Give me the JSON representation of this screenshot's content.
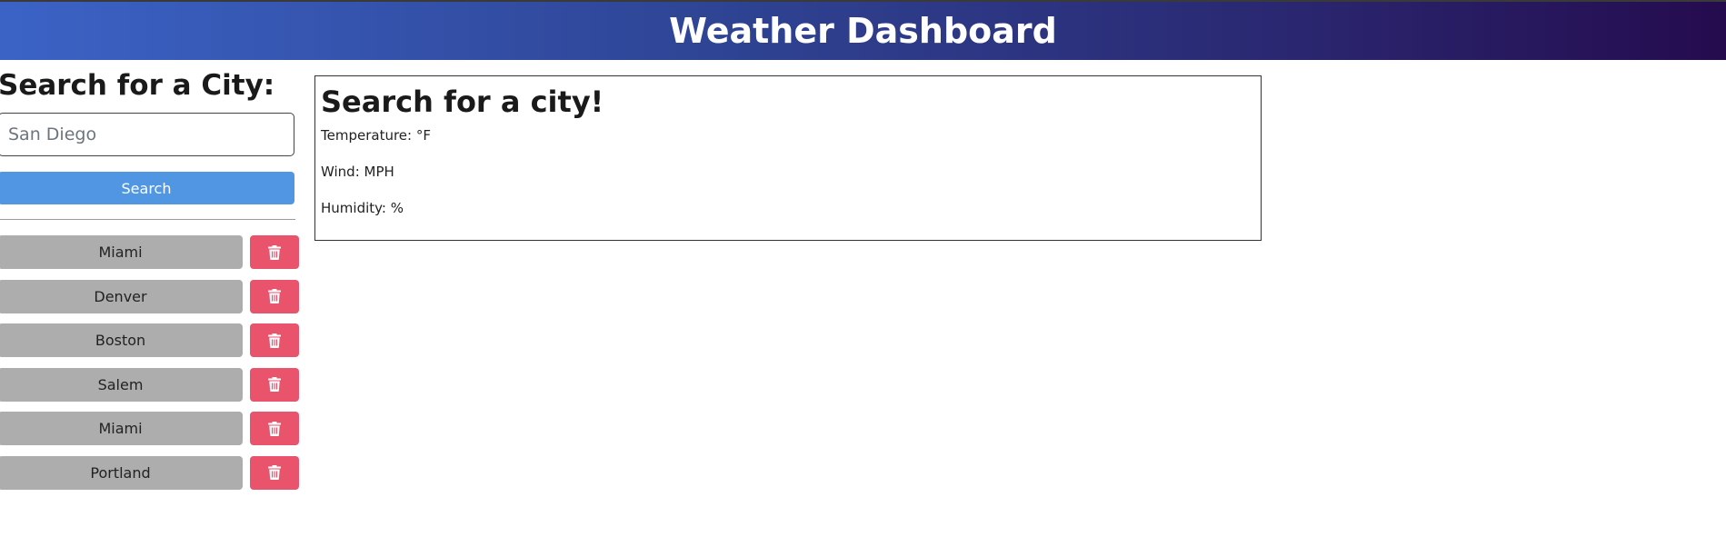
{
  "header": {
    "title": "Weather Dashboard"
  },
  "sidebar": {
    "heading": "Search for a City:",
    "search": {
      "value": "",
      "placeholder": "San Diego"
    },
    "search_button_label": "Search",
    "history": [
      {
        "city": "Miami",
        "delete_icon": "trash-icon"
      },
      {
        "city": "Denver",
        "delete_icon": "trash-icon"
      },
      {
        "city": "Boston",
        "delete_icon": "trash-icon"
      },
      {
        "city": "Salem",
        "delete_icon": "trash-icon"
      },
      {
        "city": "Miami",
        "delete_icon": "trash-icon"
      },
      {
        "city": "Portland",
        "delete_icon": "trash-icon"
      }
    ]
  },
  "current": {
    "title": "Search for a city!",
    "temperature": "Temperature: °F",
    "wind": "Wind: MPH",
    "humidity": "Humidity: %"
  },
  "colors": {
    "header_gradient_start": "#3b63c6",
    "header_gradient_end": "#250b4e",
    "search_button": "#5096e2",
    "city_button": "#adadad",
    "delete_button": "#e9546c"
  }
}
